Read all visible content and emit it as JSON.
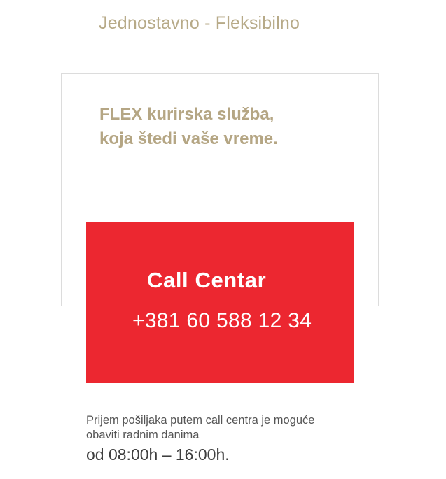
{
  "tagline": "Jednostavno - Fleksibilno",
  "card": {
    "headline_line1": "FLEX kurirska služba,",
    "headline_line2": "koja štedi vaše vreme."
  },
  "call_center": {
    "title": "Call Centar",
    "phone": "+381 60 588 12 34"
  },
  "info": {
    "line1": "Prijem pošiljaka putem call centra je moguće",
    "line2": "obaviti radnim danima",
    "hours": "od 08:00h – 16:00h."
  },
  "colors": {
    "accent_gold": "#b5a684",
    "call_red": "#ec2730",
    "text_gray": "#555555"
  }
}
